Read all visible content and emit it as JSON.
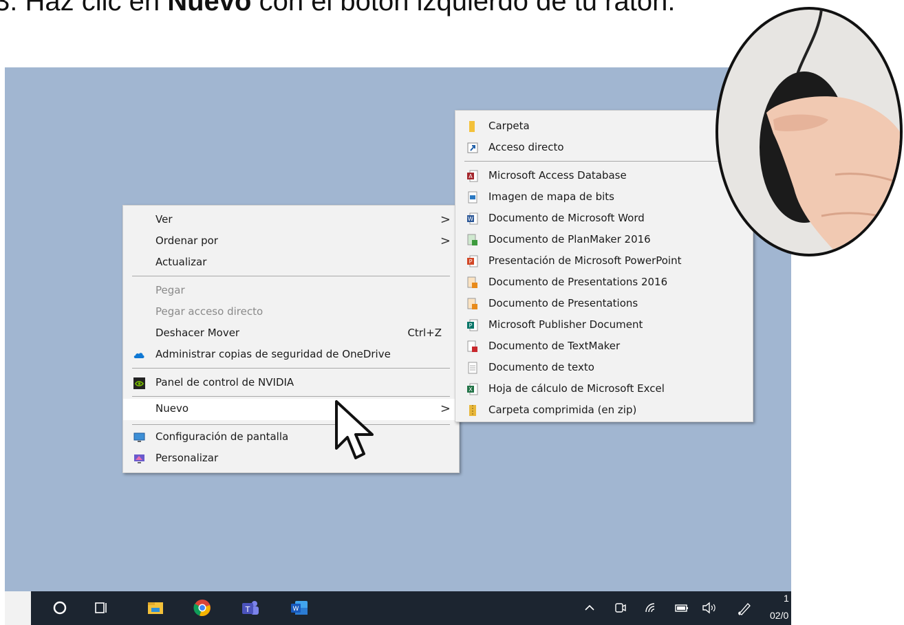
{
  "instruction": {
    "prefix": "3. Haz clic en ",
    "bold": "Nuevo",
    "suffix": " con el botón izquierdo de tu ratón."
  },
  "context_menu": {
    "items": [
      {
        "label": "Ver",
        "submenu": true
      },
      {
        "label": "Ordenar por",
        "submenu": true
      },
      {
        "label": "Actualizar"
      },
      {
        "label": "Pegar",
        "disabled": true
      },
      {
        "label": "Pegar acceso directo",
        "disabled": true
      },
      {
        "label": "Deshacer Mover",
        "shortcut": "Ctrl+Z"
      },
      {
        "label": "Administrar copias de seguridad de OneDrive",
        "icon": "onedrive-icon"
      },
      {
        "label": "Panel de control de NVIDIA",
        "icon": "nvidia-icon"
      },
      {
        "label": "Nuevo",
        "submenu": true,
        "highlighted": true
      },
      {
        "label": "Configuración de pantalla",
        "icon": "display-settings-icon"
      },
      {
        "label": "Personalizar",
        "icon": "personalize-icon"
      }
    ],
    "chevron": ">"
  },
  "submenu_nuevo": {
    "items": [
      {
        "label": "Carpeta",
        "icon": "folder-icon",
        "color": "#f3c13a"
      },
      {
        "label": "Acceso directo",
        "icon": "shortcut-icon",
        "color": "#1f5fa8"
      },
      {
        "label": "Microsoft Access Database",
        "icon": "access-icon",
        "color": "#a4262c"
      },
      {
        "label": "Imagen de mapa de bits",
        "icon": "bitmap-icon",
        "color": "#2b79c2"
      },
      {
        "label": "Documento de Microsoft Word",
        "icon": "word-icon",
        "color": "#2b5797"
      },
      {
        "label": "Documento de PlanMaker 2016",
        "icon": "planmaker-icon",
        "color": "#3d9a3d"
      },
      {
        "label": "Presentación de Microsoft PowerPoint",
        "icon": "powerpoint-icon",
        "color": "#d24726"
      },
      {
        "label": "Documento de Presentations 2016",
        "icon": "presentations-icon",
        "color": "#e88a1a"
      },
      {
        "label": "Documento de Presentations",
        "icon": "presentations-icon",
        "color": "#e88a1a"
      },
      {
        "label": "Microsoft Publisher Document",
        "icon": "publisher-icon",
        "color": "#077568"
      },
      {
        "label": "Documento de TextMaker",
        "icon": "textmaker-icon",
        "color": "#c8282d"
      },
      {
        "label": "Documento de texto",
        "icon": "text-document-icon",
        "color": "#9a9a9a"
      },
      {
        "label": "Hoja de cálculo de Microsoft Excel",
        "icon": "excel-icon",
        "color": "#217346"
      },
      {
        "label": "Carpeta comprimida (en zip)",
        "icon": "zip-folder-icon",
        "color": "#e8b73a"
      }
    ]
  },
  "taskbar": {
    "icons": [
      "search-circle-icon",
      "task-view-icon",
      "file-explorer-icon",
      "chrome-icon",
      "teams-icon",
      "word-icon"
    ],
    "tray": {
      "chevron": "^",
      "clock_partial_top": "1",
      "date_partial": "02/0"
    }
  },
  "colors": {
    "desktop": "#a1b6d1",
    "taskbar": "#1c2530",
    "menu": "#f2f2f2"
  }
}
